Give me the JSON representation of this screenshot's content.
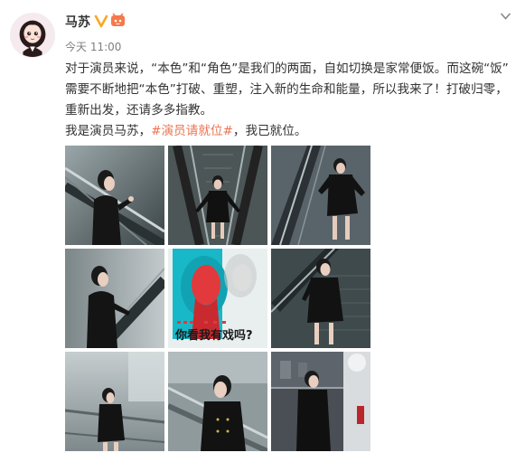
{
  "user": {
    "name": "马苏",
    "time": "今天 11:00"
  },
  "post": {
    "line1": "对于演员来说，“本色”和“角色”是我们的两面，自如切换是家常便饭。而这碗“饭”",
    "line2": "需要不断地把“本色”打破、重塑，注入新的生命和能量，所以我来了！打破归零，",
    "line3": "重新出发，还请多多指教。",
    "line4_pre": "我是演员马苏，",
    "hashtag": "#演员请就位#",
    "line4_post": "，我已就位。"
  },
  "poster": {
    "headline": "你看我有戏吗?"
  },
  "colors": {
    "hashtag": "#eb7350",
    "verified": "#f8a825",
    "text": "#333333",
    "muted": "#808080"
  },
  "icons": [
    "verified-icon",
    "member-badge-icon",
    "chevron-down-icon"
  ],
  "photos": [
    "photo-escalator-side-1",
    "photo-escalator-front",
    "photo-escalator-pose",
    "photo-escalator-side-2",
    "photo-poster",
    "photo-escalator-down",
    "photo-glass-railing",
    "photo-glass-closeup",
    "photo-mall-atrium"
  ]
}
